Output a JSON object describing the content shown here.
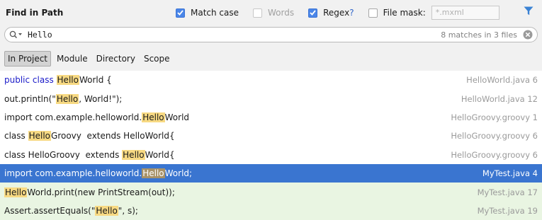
{
  "window_title": "Find in Path",
  "options": {
    "match_case": {
      "label": "Match case",
      "checked": true
    },
    "words": {
      "label": "Words",
      "checked": false
    },
    "regex": {
      "label": "Regex",
      "help": "?",
      "checked": true
    },
    "file_mask": {
      "label": "File mask:",
      "checked": false,
      "placeholder": "*.mxml"
    }
  },
  "search": {
    "query": "Hello",
    "match_count": "8 matches in 3 files"
  },
  "scopes": [
    {
      "label": "In Project",
      "selected": true
    },
    {
      "label": "Module",
      "selected": false
    },
    {
      "label": "Directory",
      "selected": false
    },
    {
      "label": "Scope",
      "selected": false
    }
  ],
  "results": [
    {
      "pre": "public class ",
      "match": "Hello",
      "post": "World {",
      "file": "HelloWorld.java 6",
      "state": "normal"
    },
    {
      "pre": "out.println(\"",
      "match": "Hello",
      "post": ", World!\");",
      "file": "HelloWorld.java 12",
      "state": "normal"
    },
    {
      "pre": "import com.example.helloworld.",
      "match": "Hello",
      "post": "World",
      "file": "HelloGroovy.groovy 1",
      "state": "normal"
    },
    {
      "pre": "class ",
      "match": "Hello",
      "post": "Groovy  extends HelloWorld{",
      "file": "HelloGroovy.groovy 6",
      "state": "normal"
    },
    {
      "pre": "class HelloGroovy  extends ",
      "match": "Hello",
      "post": "World{",
      "file": "HelloGroovy.groovy 6",
      "state": "normal"
    },
    {
      "pre": "import com.example.helloworld.",
      "match": "Hello",
      "post": "World;",
      "file": "MyTest.java 4",
      "state": "selected"
    },
    {
      "pre": "",
      "match": "Hello",
      "post": "World.print(new PrintStream(out));",
      "file": "MyTest.java 17",
      "state": "green"
    },
    {
      "pre": "Assert.assertEquals(\"",
      "match": "Hello",
      "post": "\", s);",
      "file": "MyTest.java 19",
      "state": "green"
    }
  ],
  "colors": {
    "accent": "#4a86e8",
    "selection": "#3a75d0",
    "match_highlight": "#f7d982",
    "test_row": "#e9f5e2"
  },
  "icons": {
    "filter": "filter-icon",
    "search": "search-icon",
    "clear": "clear-icon"
  }
}
